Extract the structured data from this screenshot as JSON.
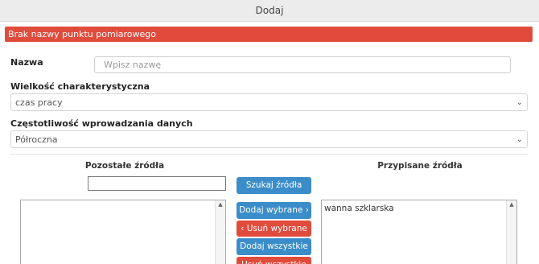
{
  "header": {
    "title": "Dodaj"
  },
  "alert": {
    "message": "Brak nazwy punktu pomiarowego"
  },
  "form": {
    "name_label": "Nazwa",
    "name_placeholder": "Wpisz nazwę",
    "name_value": "",
    "characteristic_label": "Wielkość charakterystyczna",
    "characteristic_value": "czas pracy",
    "frequency_label": "Częstotliwość wprowadzania danych",
    "frequency_value": "Półroczna"
  },
  "sources": {
    "remaining_title": "Pozostałe źródła",
    "assigned_title": "Przypisane źródła",
    "search_value": "",
    "remaining_items": [],
    "assigned_items": [
      "wanna szklarska"
    ]
  },
  "buttons": {
    "search": "Szukaj źródła",
    "add_selected": "Dodaj wybrane ›",
    "remove_selected": "‹ Usuń wybrane",
    "add_all": "Dodaj wszystkie",
    "remove_all": "Usuń wszystkie"
  },
  "icons": {
    "chevron_down": "chevron-down-icon",
    "arrow_circle_right": "arrow-circle-right-icon",
    "scroll_up": "scroll-up-arrow-icon"
  },
  "colors": {
    "primary": "#3b8dc9",
    "danger": "#e04b3c",
    "header_bg": "#ececec"
  }
}
